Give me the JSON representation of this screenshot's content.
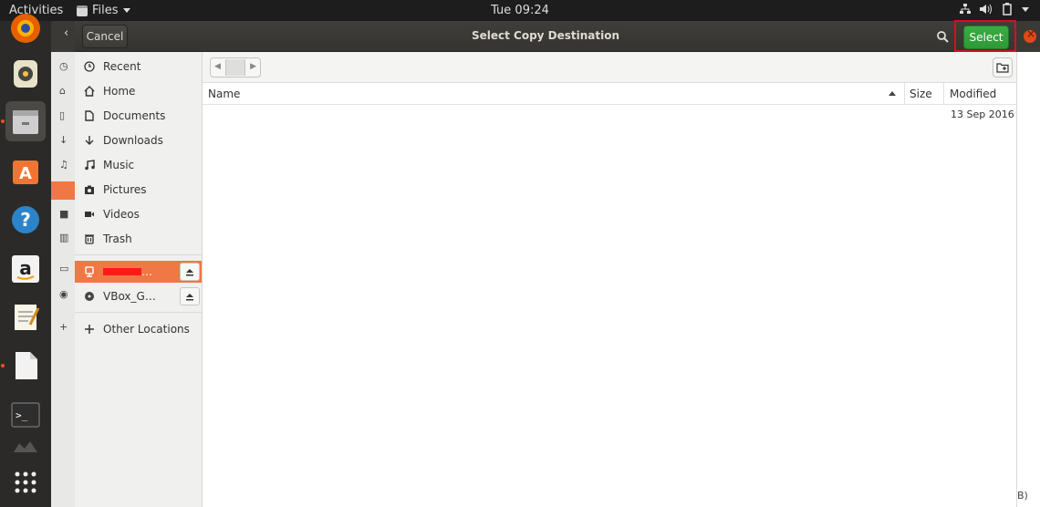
{
  "topbar": {
    "activities": "Activities",
    "app_menu": "Files",
    "clock": "Tue 09:24"
  },
  "dock": {
    "items": [
      "firefox-icon",
      "rhythmbox-icon",
      "files-icon",
      "ubuntu-software-icon",
      "help-icon",
      "amazon-icon",
      "text-editor-icon",
      "libreoffice-icon",
      "terminal-icon",
      "trash-icon",
      "show-apps-icon"
    ]
  },
  "dialog": {
    "title": "Select Copy Destination",
    "cancel_label": "Cancel",
    "select_label": "Select",
    "highlight_color": "#d4101f",
    "select_color": "#3aac43"
  },
  "sidebar": {
    "items": [
      {
        "label": "Recent",
        "icon": "clock-icon"
      },
      {
        "label": "Home",
        "icon": "home-icon"
      },
      {
        "label": "Documents",
        "icon": "document-icon"
      },
      {
        "label": "Downloads",
        "icon": "download-icon"
      },
      {
        "label": "Music",
        "icon": "music-icon"
      },
      {
        "label": "Pictures",
        "icon": "camera-icon"
      },
      {
        "label": "Videos",
        "icon": "video-icon"
      },
      {
        "label": "Trash",
        "icon": "trash-icon"
      }
    ],
    "devices": [
      {
        "label": "…",
        "icon": "usb-drive-icon",
        "selected": true,
        "redacted": true
      },
      {
        "label": "VBox_G…",
        "icon": "disc-icon",
        "selected": false
      }
    ],
    "other_locations": "Other Locations",
    "selected_color": "#f07746"
  },
  "file_list": {
    "columns": {
      "name": "Name",
      "size": "Size",
      "modified": "Modified"
    },
    "sort": "name-ascending",
    "rows": [
      {
        "name": "",
        "size": "",
        "modified": "13 Sep 2016"
      }
    ]
  },
  "background_window": {
    "trailing_text": "B)"
  }
}
